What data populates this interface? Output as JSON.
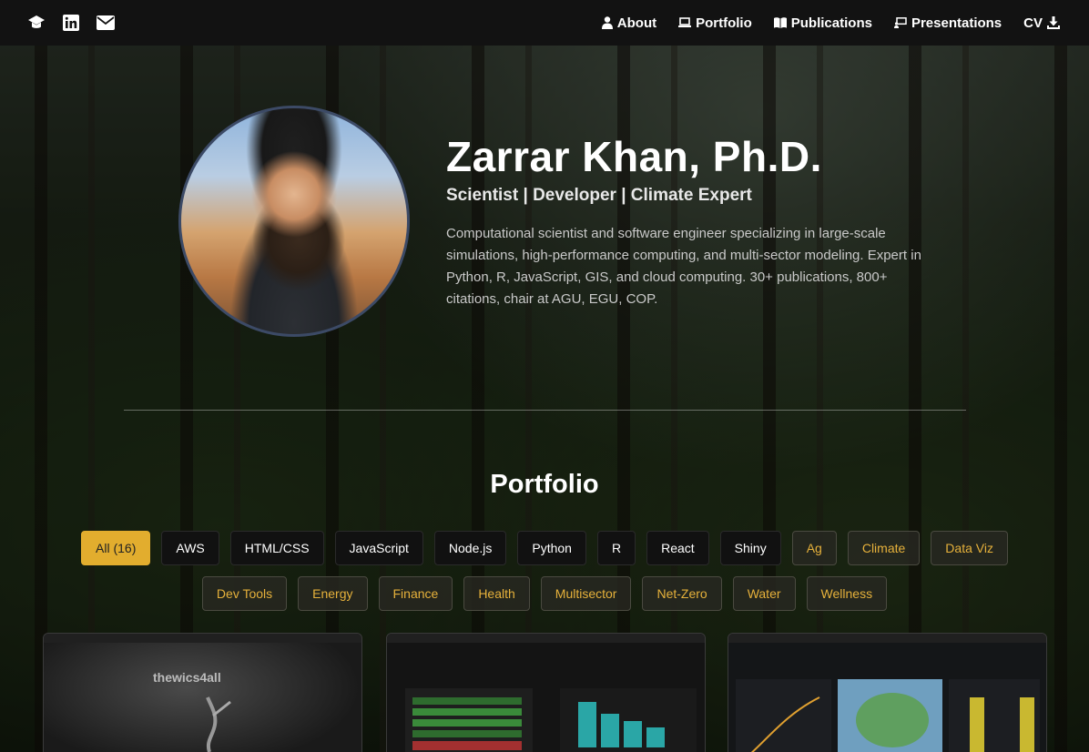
{
  "nav": {
    "links": [
      {
        "label": "About",
        "icon": "user-icon"
      },
      {
        "label": "Portfolio",
        "icon": "laptop-icon"
      },
      {
        "label": "Publications",
        "icon": "book-icon"
      },
      {
        "label": "Presentations",
        "icon": "presentation-icon"
      },
      {
        "label": "CV",
        "icon": "download-icon"
      }
    ],
    "social_icons": [
      "graduation-cap-icon",
      "linkedin-icon",
      "envelope-icon"
    ]
  },
  "hero": {
    "name": "Zarrar Khan, Ph.D.",
    "tagline": "Scientist | Developer | Climate Expert",
    "bio": "Computational scientist and software engineer specializing in large-scale simulations, high-performance computing, and multi-sector modeling. Expert in Python, R, JavaScript, GIS, and cloud computing. 30+ publications, 800+ citations, chair at AGU, EGU, COP."
  },
  "portfolio": {
    "title": "Portfolio",
    "filters": [
      {
        "label": "All (16)",
        "kind": "active"
      },
      {
        "label": "AWS",
        "kind": "tech"
      },
      {
        "label": "HTML/CSS",
        "kind": "tech"
      },
      {
        "label": "JavaScript",
        "kind": "tech"
      },
      {
        "label": "Node.js",
        "kind": "tech"
      },
      {
        "label": "Python",
        "kind": "tech"
      },
      {
        "label": "R",
        "kind": "tech"
      },
      {
        "label": "React",
        "kind": "tech"
      },
      {
        "label": "Shiny",
        "kind": "tech"
      },
      {
        "label": "Ag",
        "kind": "theme"
      },
      {
        "label": "Climate",
        "kind": "theme"
      },
      {
        "label": "Data Viz",
        "kind": "theme"
      },
      {
        "label": "Dev Tools",
        "kind": "theme"
      },
      {
        "label": "Energy",
        "kind": "theme"
      },
      {
        "label": "Finance",
        "kind": "theme"
      },
      {
        "label": "Health",
        "kind": "theme"
      },
      {
        "label": "Multisector",
        "kind": "theme"
      },
      {
        "label": "Net-Zero",
        "kind": "theme"
      },
      {
        "label": "Water",
        "kind": "theme"
      },
      {
        "label": "Wellness",
        "kind": "theme"
      }
    ],
    "cards": [
      {
        "logo_text": "thewics4all"
      },
      {},
      {}
    ]
  },
  "colors": {
    "accent": "#e2ad2e",
    "navbar": "#121212",
    "theme_chip_text": "#e6b13b"
  }
}
